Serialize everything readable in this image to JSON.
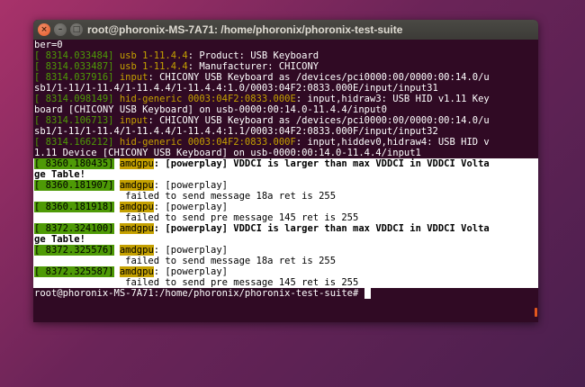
{
  "window": {
    "title": "root@phoronix-MS-7A71: /home/phoronix/phoronix-test-suite",
    "buttons": {
      "close": "×",
      "minimize": "–",
      "maximize": "□"
    }
  },
  "colors": {
    "timestamp": "#4e9a06",
    "facility": "#c4a000",
    "background": "#300a24",
    "accent_scroll": "#e2571e"
  },
  "terminal": {
    "lines": [
      {
        "kind": "plain",
        "text": "ber=0"
      },
      {
        "kind": "dmesg",
        "ts": "[ 8314.033484]",
        "fac": "usb 1-11.4.4",
        "msg": ": Product: USB Keyboard"
      },
      {
        "kind": "dmesg",
        "ts": "[ 8314.033487]",
        "fac": "usb 1-11.4.4",
        "msg": ": Manufacturer: CHICONY"
      },
      {
        "kind": "dmesg",
        "ts": "[ 8314.037916]",
        "fac": "input",
        "msg": ": CHICONY USB Keyboard as /devices/pci0000:00/0000:00:14.0/u"
      },
      {
        "kind": "plain",
        "text": "sb1/1-11/1-11.4/1-11.4.4/1-11.4.4:1.0/0003:04F2:0833.000E/input/input31"
      },
      {
        "kind": "dmesg",
        "ts": "[ 8314.098149]",
        "fac": "hid-generic 0003:04F2:0833.000E",
        "msg": ": input,hidraw3: USB HID v1.11 Key"
      },
      {
        "kind": "plain",
        "text": "board [CHICONY USB Keyboard] on usb-0000:00:14.0-11.4.4/input0"
      },
      {
        "kind": "dmesg",
        "ts": "[ 8314.106713]",
        "fac": "input",
        "msg": ": CHICONY USB Keyboard as /devices/pci0000:00/0000:00:14.0/u"
      },
      {
        "kind": "plain",
        "text": "sb1/1-11/1-11.4/1-11.4.4/1-11.4.4:1.1/0003:04F2:0833.000F/input/input32"
      },
      {
        "kind": "dmesg",
        "ts": "[ 8314.166212]",
        "fac": "hid-generic 0003:04F2:0833.000F",
        "msg": ": input,hiddev0,hidraw4: USB HID v"
      },
      {
        "kind": "plain",
        "text": "1.11 Device [CHICONY USB Keyboard] on usb-0000:00:14.0-11.4.4/input1"
      },
      {
        "kind": "hl",
        "ts": "[ 8360.180435]",
        "fac": "amdgpu",
        "msg": ": [powerplay] VDDCI is larger than max VDDCI in VDDCI Volta",
        "bold": true
      },
      {
        "kind": "hl-plain",
        "text": "ge Table!",
        "bold": true
      },
      {
        "kind": "hl",
        "ts": "[ 8360.181907]",
        "fac": "amdgpu",
        "msg": ": [powerplay]",
        "bold": false
      },
      {
        "kind": "hl-plain",
        "text": "                failed to send message 18a ret is 255",
        "bold": false
      },
      {
        "kind": "hl",
        "ts": "[ 8360.181918]",
        "fac": "amdgpu",
        "msg": ": [powerplay]",
        "bold": false
      },
      {
        "kind": "hl-plain",
        "text": "                failed to send pre message 145 ret is 255",
        "bold": false
      },
      {
        "kind": "hl",
        "ts": "[ 8372.324100]",
        "fac": "amdgpu",
        "msg": ": [powerplay] VDDCI is larger than max VDDCI in VDDCI Volta",
        "bold": true
      },
      {
        "kind": "hl-plain",
        "text": "ge Table!",
        "bold": true
      },
      {
        "kind": "hl",
        "ts": "[ 8372.325576]",
        "fac": "amdgpu",
        "msg": ": [powerplay]",
        "bold": false
      },
      {
        "kind": "hl-plain",
        "text": "                failed to send message 18a ret is 255",
        "bold": false
      },
      {
        "kind": "hl",
        "ts": "[ 8372.325587]",
        "fac": "amdgpu",
        "msg": ": [powerplay]",
        "bold": false
      },
      {
        "kind": "hl-plain",
        "text": "                failed to send pre message 145 ret is 255",
        "bold": false
      }
    ],
    "prompt": "root@phoronix-MS-7A71:/home/phoronix/phoronix-test-suite# "
  }
}
